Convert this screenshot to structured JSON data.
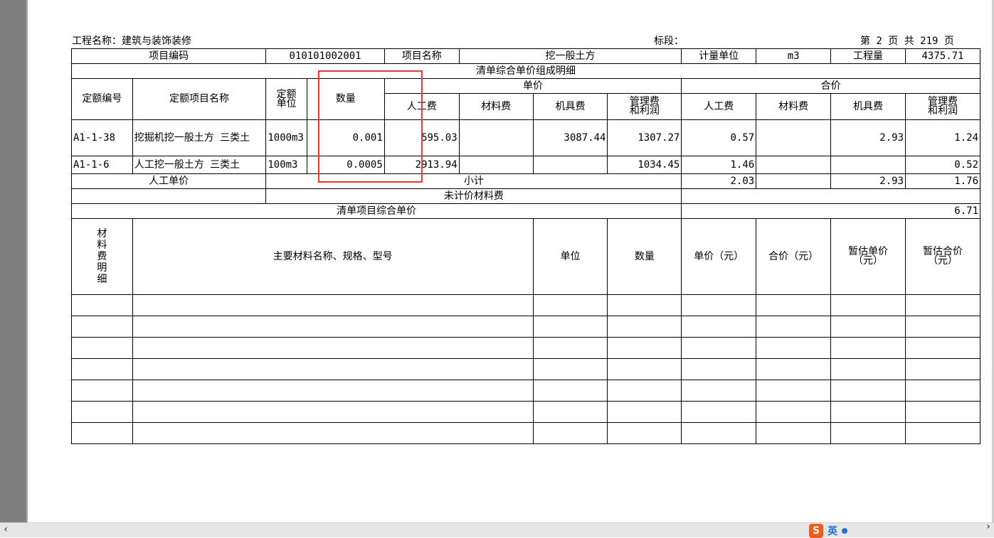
{
  "header": {
    "project_label": "工程名称：建筑与装饰装修",
    "segment_label": "标段：",
    "page_label": "第 2 页  共 219 页"
  },
  "row1": {
    "code_label": "项目编码",
    "code_value": "010101002001",
    "name_label": "项目名称",
    "name_value": "挖一般土方",
    "unit_label": "计量单位",
    "unit_value": "m3",
    "qty_label": "工程量",
    "qty_value": "4375.71"
  },
  "section_title": "清单综合单价组成明细",
  "columns": {
    "quota_code": "定额编号",
    "quota_name": "定额项目名称",
    "quota_unit_1": "定额",
    "quota_unit_2": "单位",
    "quantity": "数量",
    "unit_price": "单价",
    "total_price": "合价",
    "labor": "人工费",
    "material": "材料费",
    "machine": "机具费",
    "mgmt_1": "管理费",
    "mgmt_2": "和利润"
  },
  "rows": [
    {
      "code": "A1-1-38",
      "name": "挖掘机挖一般土方 三类土",
      "unit": "1000m3",
      "qty": "0.001",
      "u_labor": "595.03",
      "u_material": "",
      "u_machine": "3087.44",
      "u_mgmt": "1307.27",
      "t_labor": "0.57",
      "t_material": "",
      "t_machine": "2.93",
      "t_mgmt": "1.24"
    },
    {
      "code": "A1-1-6",
      "name": "人工挖一般土方 三类土",
      "unit": "100m3",
      "qty": "0.0005",
      "u_labor": "2913.94",
      "u_material": "",
      "u_machine": "",
      "u_mgmt": "1034.45",
      "t_labor": "1.46",
      "t_material": "",
      "t_machine": "",
      "t_mgmt": "0.52"
    }
  ],
  "summary": {
    "labor_unit_price": "人工单价",
    "subtotal_label": "小计",
    "subtotal_labor": "2.03",
    "subtotal_material": "",
    "subtotal_machine": "2.93",
    "subtotal_mgmt": "1.76",
    "unpriced_material": "未计价材料费",
    "composite_label": "清单项目综合单价",
    "composite_value": "6.71"
  },
  "materials": {
    "side_label": "材料费明细",
    "name_label": "主要材料名称、规格、型号",
    "unit": "单位",
    "qty": "数量",
    "unit_price": "单价（元）",
    "total": "合价（元）",
    "est_unit_1": "暂估单价",
    "est_unit_2": "（元）",
    "est_total_1": "暂估合价",
    "est_total_2": "（元）"
  },
  "ime": {
    "label": "英"
  },
  "colors": {
    "highlight": "#e53935",
    "ime": "#f25a1a"
  }
}
